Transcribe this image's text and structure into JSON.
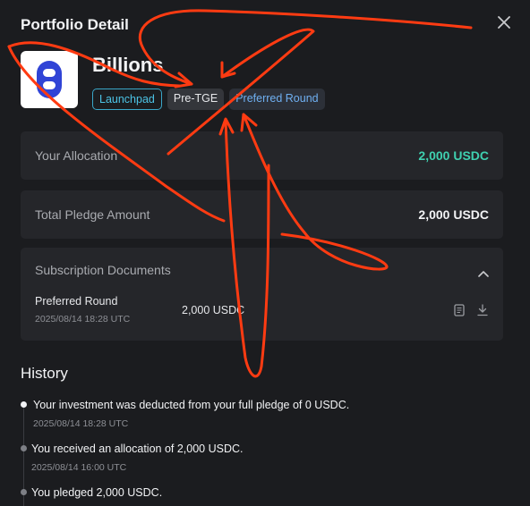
{
  "modal": {
    "title": "Portfolio Detail"
  },
  "project": {
    "name": "Billions",
    "tags": [
      "Launchpad",
      "Pre-TGE",
      "Preferred Round"
    ]
  },
  "allocation": {
    "label": "Your Allocation",
    "value": "2,000 USDC",
    "value_color": "#3fd0b0"
  },
  "pledge": {
    "label": "Total Pledge Amount",
    "value": "2,000 USDC"
  },
  "subscription": {
    "title": "Subscription Documents",
    "doc": {
      "name": "Preferred Round",
      "date": "2025/08/14 18:28 UTC",
      "amount": "2,000 USDC"
    }
  },
  "history": {
    "title": "History",
    "items": [
      {
        "text": "Your investment was deducted from your full pledge of 0 USDC.",
        "date": "2025/08/14 18:28 UTC"
      },
      {
        "text": "You received an allocation of 2,000 USDC.",
        "date": "2025/08/14 16:00 UTC"
      },
      {
        "text": "You pledged 2,000 USDC.",
        "date": ""
      }
    ]
  },
  "annotation_color": "#ff3b12"
}
